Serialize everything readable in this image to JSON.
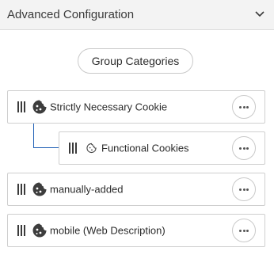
{
  "header": {
    "title": "Advanced Configuration",
    "chevron_icon": "chevron-down-icon"
  },
  "group_button": {
    "label": "Group Categories"
  },
  "categories": [
    {
      "label": "Strictly Necessary Cookie",
      "icon": "cookie-icon",
      "more_icon": "more-options-icon",
      "drag_icon": "drag-handle-icon"
    },
    {
      "label": "Functional Cookies",
      "icon": "cookie-outline-icon",
      "more_icon": "more-options-icon",
      "drag_icon": "drag-handle-icon"
    },
    {
      "label": "manually-added",
      "icon": "cookie-icon",
      "more_icon": "more-options-icon",
      "drag_icon": "drag-handle-icon"
    },
    {
      "label": "mobile (Web Description)",
      "icon": "cookie-icon",
      "more_icon": "more-options-icon",
      "drag_icon": "drag-handle-icon"
    }
  ],
  "colors": {
    "connector": "#1f5fb5",
    "header_bg": "#f3f3f3"
  }
}
